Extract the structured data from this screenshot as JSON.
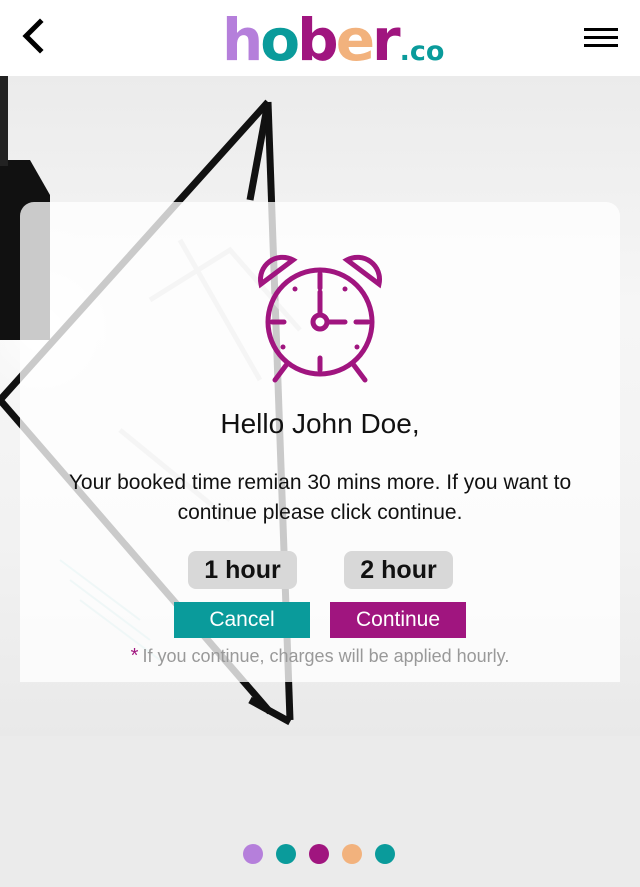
{
  "header": {
    "logo": {
      "letters": [
        "h",
        "o",
        "b",
        "e",
        "r"
      ],
      "suffix": ".co"
    },
    "icons": {
      "back": "chevron-left-icon",
      "menu": "hamburger-menu-icon"
    }
  },
  "modal": {
    "icon": "alarm-clock-icon",
    "greeting": "Hello John Doe,",
    "message_line1": "Your booked time remian 30 mins more. If you want to",
    "message_line2": "continue please click continue.",
    "options": [
      "1 hour",
      "2 hour"
    ],
    "cancel_label": "Cancel",
    "continue_label": "Continue",
    "note_star": "*",
    "note": "If you continue, charges will be applied hourly."
  },
  "carousel": {
    "dot_colors": [
      "#b57fdb",
      "#0a9b9b",
      "#a0157f",
      "#f2b27d",
      "#0a9b9b"
    ]
  },
  "colors": {
    "logo": [
      "#b57fdb",
      "#0a9b9b",
      "#a0157f",
      "#f2b27d",
      "#a0157f",
      "#0a9b9b"
    ],
    "accent_teal": "#0a9b9b",
    "accent_magenta": "#a0157f",
    "option_bg": "#d8d8d8"
  }
}
